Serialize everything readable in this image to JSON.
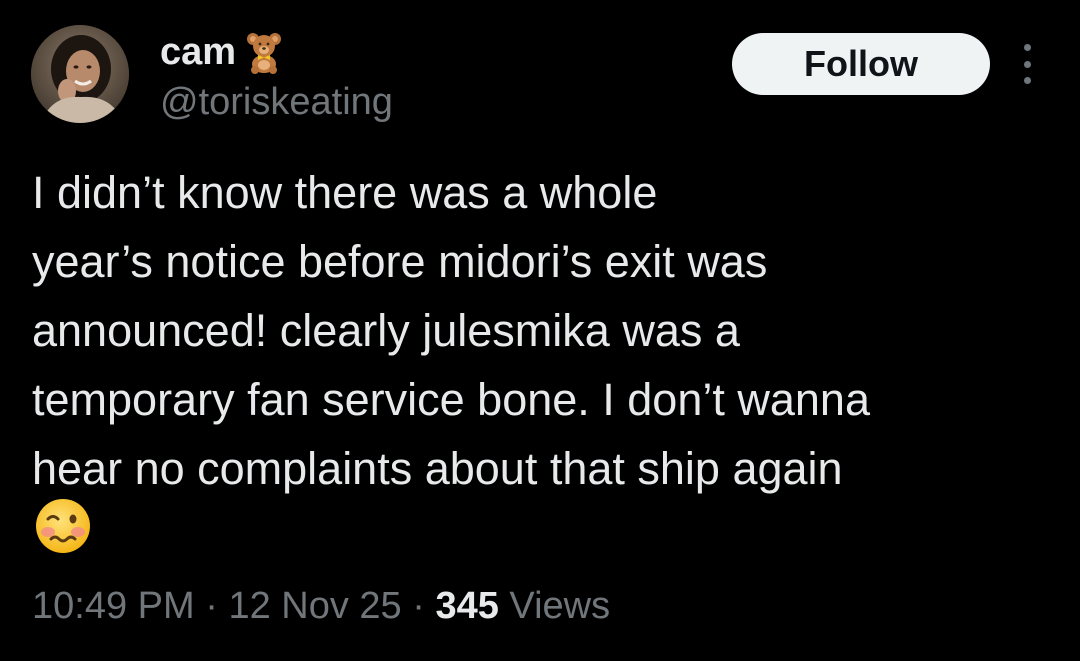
{
  "author": {
    "display_name": "cam",
    "name_emoji": "teddy-bear-emoji",
    "handle": "@toriskeating",
    "avatar": "profile-photo"
  },
  "actions": {
    "follow_label": "Follow",
    "more_icon": "more-vertical-icon"
  },
  "tweet": {
    "lines": [
      "I didn’t know there was a whole",
      "year’s notice before midori’s exit was",
      "announced! clearly julesmika was a",
      "temporary fan service bone. I don’t wanna",
      "hear no complaints about that ship again"
    ],
    "trailing_emoji": "woozy-face-emoji"
  },
  "meta": {
    "time": "10:49 PM",
    "separator": "·",
    "date": "12 Nov 25",
    "views_count": "345",
    "views_label": "Views"
  },
  "colors": {
    "background": "#000000",
    "primary_text": "#e7e9ea",
    "secondary_text": "#71767b",
    "follow_button_bg": "#eff3f4",
    "follow_button_text": "#0f1419"
  }
}
